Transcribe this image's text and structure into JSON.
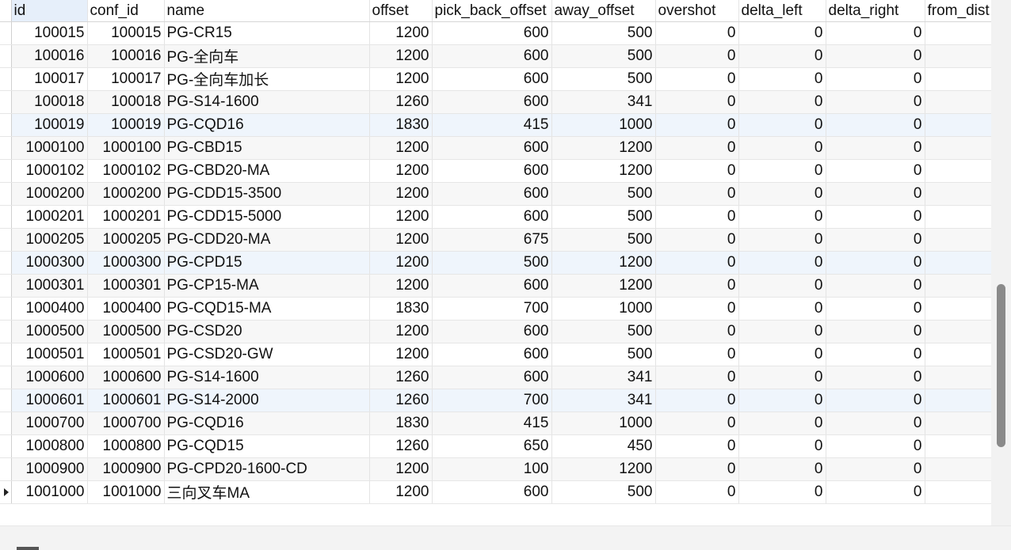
{
  "table": {
    "columns": [
      "id",
      "conf_id",
      "name",
      "offset",
      "pick_back_offset",
      "away_offset",
      "overshot",
      "delta_left",
      "delta_right",
      "from_dist"
    ],
    "rows": [
      [
        "100015",
        "100015",
        "PG-CR15",
        "1200",
        "600",
        "500",
        "0",
        "0",
        "0",
        ""
      ],
      [
        "100016",
        "100016",
        "PG-全向车",
        "1200",
        "600",
        "500",
        "0",
        "0",
        "0",
        ""
      ],
      [
        "100017",
        "100017",
        "PG-全向车加长",
        "1200",
        "600",
        "500",
        "0",
        "0",
        "0",
        ""
      ],
      [
        "100018",
        "100018",
        "PG-S14-1600",
        "1260",
        "600",
        "341",
        "0",
        "0",
        "0",
        ""
      ],
      [
        "100019",
        "100019",
        "PG-CQD16",
        "1830",
        "415",
        "1000",
        "0",
        "0",
        "0",
        ""
      ],
      [
        "1000100",
        "1000100",
        "PG-CBD15",
        "1200",
        "600",
        "1200",
        "0",
        "0",
        "0",
        ""
      ],
      [
        "1000102",
        "1000102",
        "PG-CBD20-MA",
        "1200",
        "600",
        "1200",
        "0",
        "0",
        "0",
        ""
      ],
      [
        "1000200",
        "1000200",
        "PG-CDD15-3500",
        "1200",
        "600",
        "500",
        "0",
        "0",
        "0",
        ""
      ],
      [
        "1000201",
        "1000201",
        "PG-CDD15-5000",
        "1200",
        "600",
        "500",
        "0",
        "0",
        "0",
        ""
      ],
      [
        "1000205",
        "1000205",
        "PG-CDD20-MA",
        "1200",
        "675",
        "500",
        "0",
        "0",
        "0",
        ""
      ],
      [
        "1000300",
        "1000300",
        "PG-CPD15",
        "1200",
        "500",
        "1200",
        "0",
        "0",
        "0",
        ""
      ],
      [
        "1000301",
        "1000301",
        "PG-CP15-MA",
        "1200",
        "600",
        "1200",
        "0",
        "0",
        "0",
        ""
      ],
      [
        "1000400",
        "1000400",
        "PG-CQD15-MA",
        "1830",
        "700",
        "1000",
        "0",
        "0",
        "0",
        ""
      ],
      [
        "1000500",
        "1000500",
        "PG-CSD20",
        "1200",
        "600",
        "500",
        "0",
        "0",
        "0",
        ""
      ],
      [
        "1000501",
        "1000501",
        "PG-CSD20-GW",
        "1200",
        "600",
        "500",
        "0",
        "0",
        "0",
        ""
      ],
      [
        "1000600",
        "1000600",
        "PG-S14-1600",
        "1260",
        "600",
        "341",
        "0",
        "0",
        "0",
        ""
      ],
      [
        "1000601",
        "1000601",
        "PG-S14-2000",
        "1260",
        "700",
        "341",
        "0",
        "0",
        "0",
        ""
      ],
      [
        "1000700",
        "1000700",
        "PG-CQD16",
        "1830",
        "415",
        "1000",
        "0",
        "0",
        "0",
        ""
      ],
      [
        "1000800",
        "1000800",
        "PG-CQD15",
        "1260",
        "650",
        "450",
        "0",
        "0",
        "0",
        ""
      ],
      [
        "1000900",
        "1000900",
        "PG-CPD20-1600-CD",
        "1200",
        "100",
        "1200",
        "0",
        "0",
        "0",
        ""
      ],
      [
        "1001000",
        "1001000",
        "三向叉车MA",
        "1200",
        "600",
        "500",
        "0",
        "0",
        "0",
        ""
      ]
    ]
  },
  "ui": {
    "sorted_column": 0,
    "current_row": 20,
    "highlighted_rows": [
      4,
      10,
      16
    ],
    "vertical_scroll_fraction": 0.7,
    "vertical_visible_fraction": 0.31
  },
  "colors": {
    "header_sorted": "#e6effa",
    "row_highlight": "#eff5fc",
    "row_alt": "#f7f7f7",
    "scroll_thumb": "#8a8a8a"
  },
  "icons": {
    "current_row_marker": "triangle-right-icon"
  }
}
